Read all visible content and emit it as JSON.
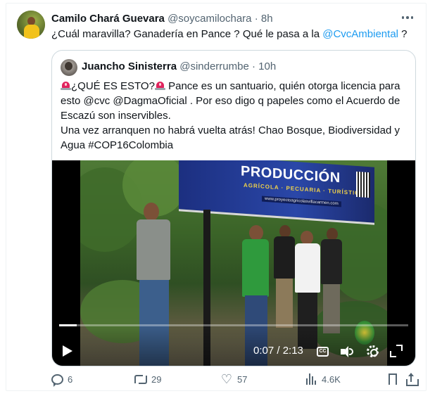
{
  "tweet": {
    "author_name": "Camilo Chará Guevara",
    "author_handle": "@soycamilochara",
    "separator": "·",
    "time": "8h",
    "text_before": "¿Cuál maravilla? Ganadería en Pance ? Qué le pasa a la ",
    "mention": "@CvcAmbiental",
    "text_after": " ?"
  },
  "quoted": {
    "author_name": "Juancho Sinisterra",
    "author_handle": "@sinderrumbe",
    "separator": "·",
    "time": "10h",
    "line1_a": "¿QUÉ ES ESTO?",
    "line1_b": " Pance es un santuario, quién otorga licencia para esto  @cvc @DagmaOficial . Por eso digo q papeles como el Acuerdo de Escazú son inservibles.",
    "line2": "Una vez arranquen no habrá vuelta atrás! Chao Bosque, Biodiversidad y Agua #COP16Colombia",
    "video": {
      "banner_title": "PRODUCCIÓN",
      "banner_sub": "AGRÍCOLA · PECUARIA · TURÍSTICA",
      "banner_url": "www.proyectoagricolasvillacarmen.com",
      "current_time": "0:07",
      "duration": "2:13",
      "time_display": "0:07 / 2:13",
      "progress": 0.05,
      "cc_label": "CC"
    }
  },
  "actions": {
    "replies": "6",
    "reposts": "29",
    "likes": "57",
    "views": "4.6K"
  },
  "colors": {
    "link": "#1d9bf0",
    "muted": "#536471",
    "border": "#cfd9de"
  }
}
